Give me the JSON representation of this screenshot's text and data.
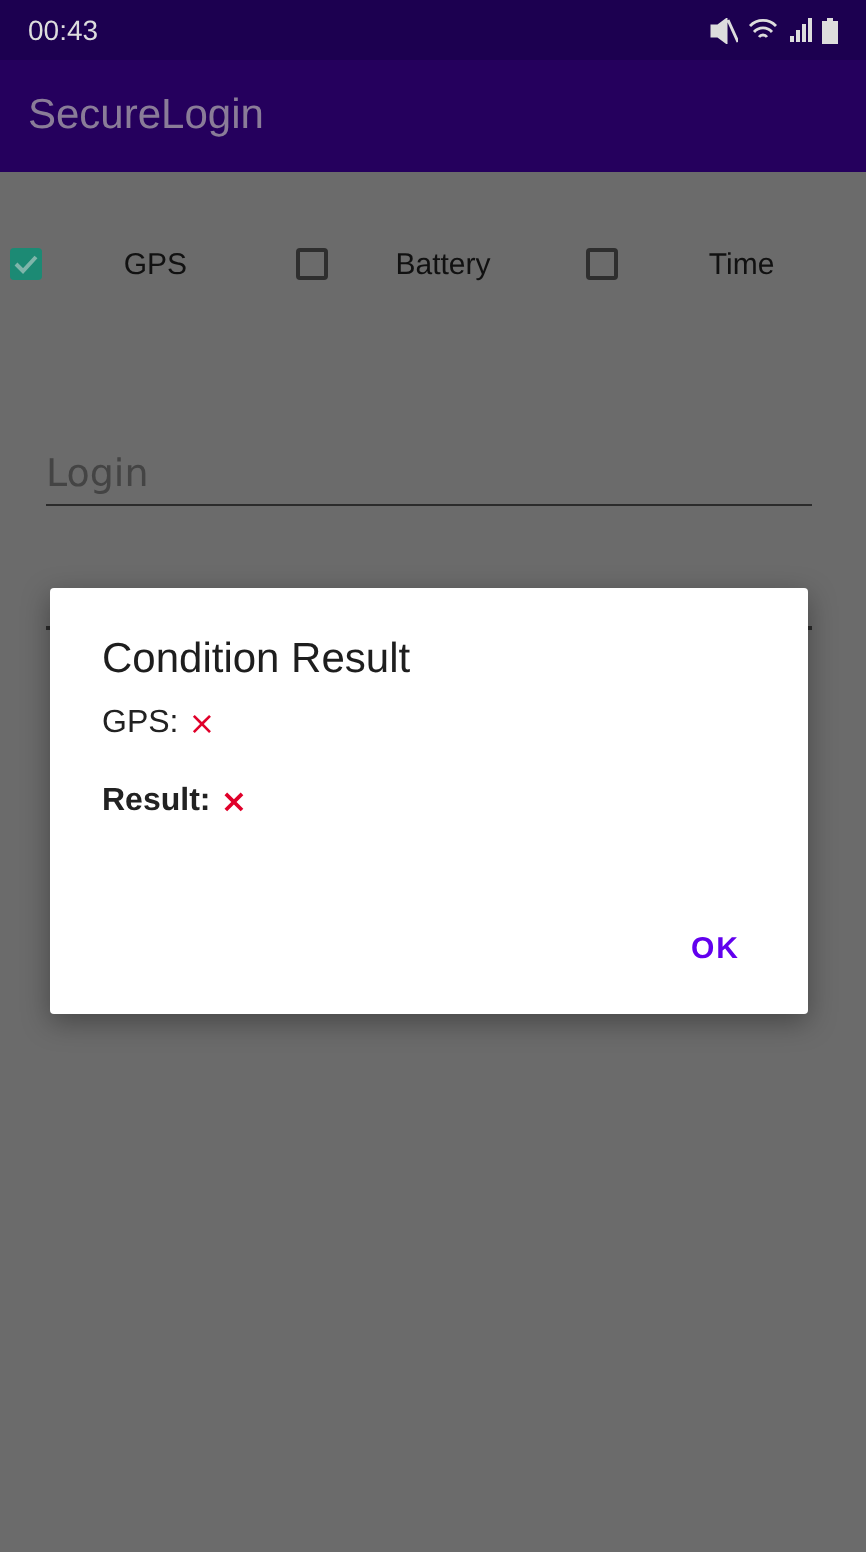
{
  "status_bar": {
    "time": "00:43"
  },
  "app_bar": {
    "title": "SecureLogin"
  },
  "conditions": [
    {
      "label": "GPS",
      "checked": true
    },
    {
      "label": "Battery",
      "checked": false
    },
    {
      "label": "Time",
      "checked": false
    }
  ],
  "login_field": {
    "placeholder": "Login"
  },
  "dialog": {
    "title": "Condition Result",
    "lines": [
      {
        "kind": "condition",
        "label": "GPS:",
        "mark": "×"
      },
      {
        "kind": "summary",
        "label": "Result:",
        "mark": "×"
      }
    ],
    "button": "OK"
  }
}
